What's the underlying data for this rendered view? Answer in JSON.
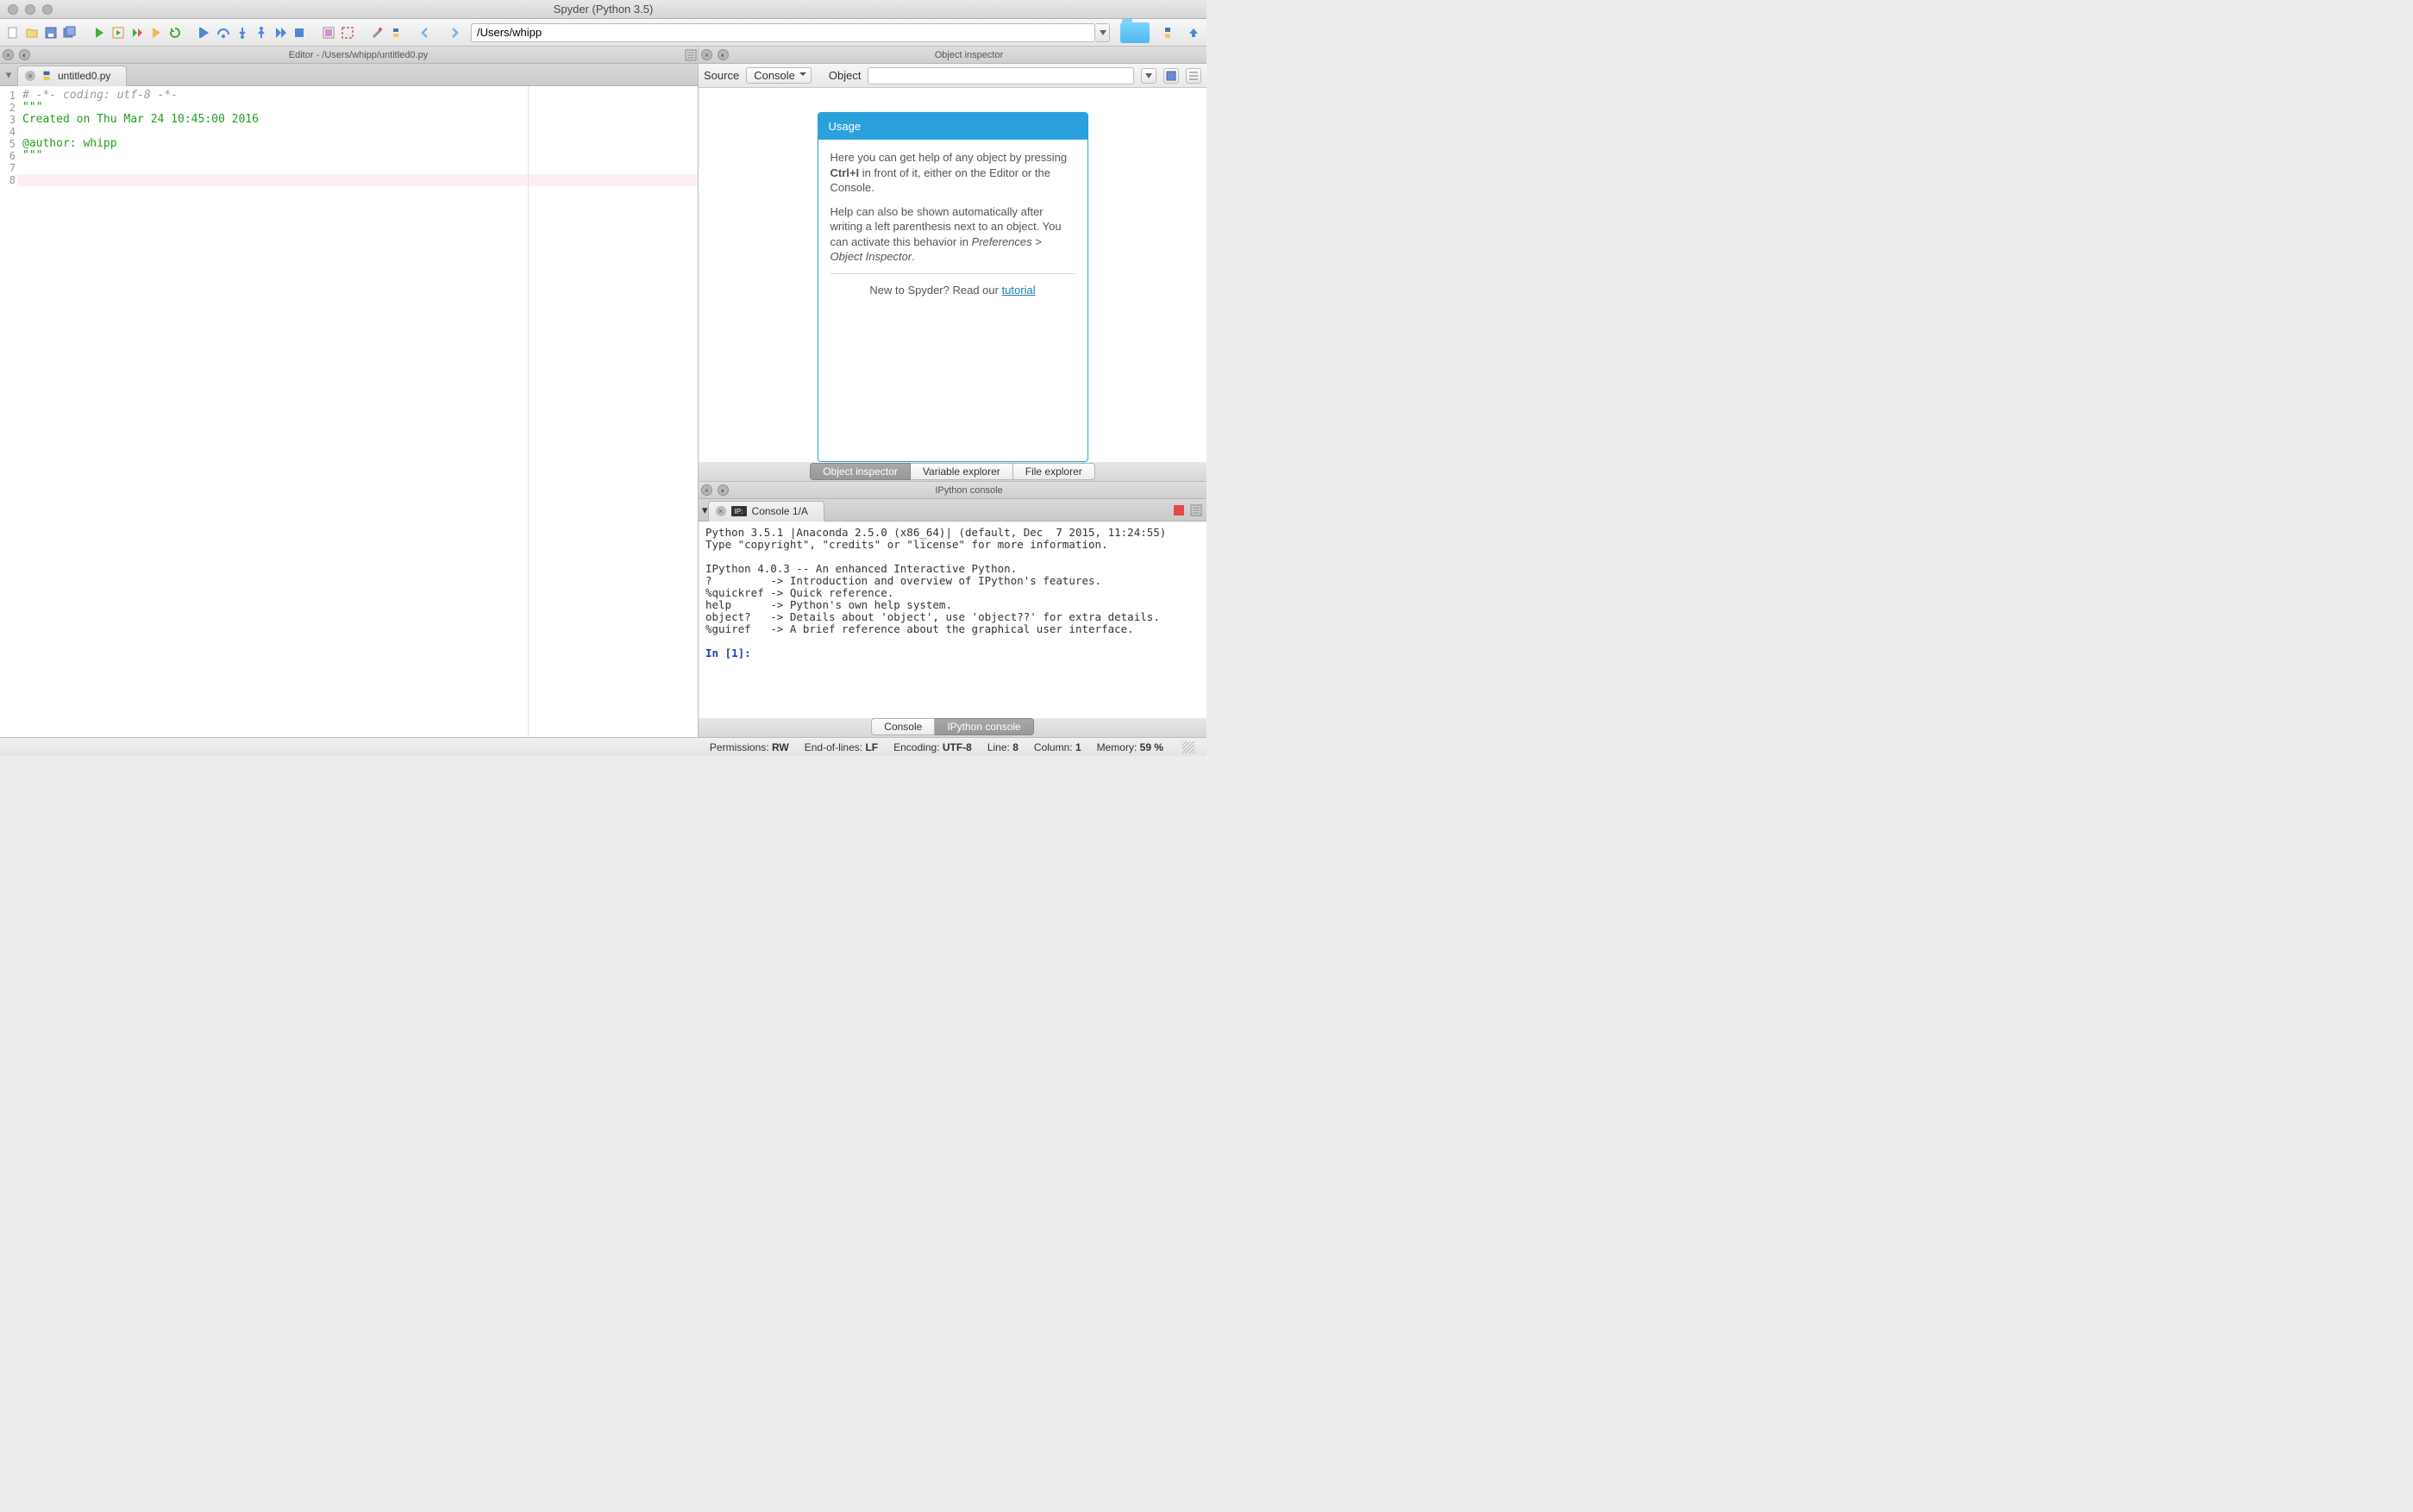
{
  "window": {
    "title": "Spyder (Python 3.5)"
  },
  "toolbar": {
    "working_dir": "/Users/whipp"
  },
  "editor": {
    "pane_title": "Editor - /Users/whipp/untitled0.py",
    "tab_name": "untitled0.py",
    "gutter": "1\n2\n3\n4\n5\n6\n7\n8",
    "line1": "# -*- coding: utf-8 -*-",
    "line2": "\"\"\"",
    "line3": "Created on Thu Mar 24 10:45:00 2016",
    "line4": "",
    "line5": "@author: whipp",
    "line6": "\"\"\"",
    "line7": "",
    "line8": ""
  },
  "inspector": {
    "pane_title": "Object inspector",
    "source_label": "Source",
    "source_value": "Console",
    "object_label": "Object",
    "usage_title": "Usage",
    "usage_p1a": "Here you can get help of any object by pressing ",
    "usage_key": "Ctrl+I",
    "usage_p1b": " in front of it, either on the Editor or the Console.",
    "usage_p2a": "Help can also be shown automatically after writing a left parenthesis next to an object. You can activate this behavior in ",
    "usage_pref": "Preferences > Object Inspector",
    "usage_p2b": ".",
    "usage_foot": "New to Spyder? Read our ",
    "usage_link": "tutorial",
    "tabs": {
      "obj": "Object inspector",
      "var": "Variable explorer",
      "file": "File explorer"
    }
  },
  "console": {
    "pane_title": "IPython console",
    "tab_name": "Console 1/A",
    "l1": "Python 3.5.1 |Anaconda 2.5.0 (x86_64)| (default, Dec  7 2015, 11:24:55) ",
    "l2": "Type \"copyright\", \"credits\" or \"license\" for more information.",
    "l3": "",
    "l4": "IPython 4.0.3 -- An enhanced Interactive Python.",
    "l5": "?         -> Introduction and overview of IPython's features.",
    "l6": "%quickref -> Quick reference.",
    "l7": "help      -> Python's own help system.",
    "l8": "object?   -> Details about 'object', use 'object??' for extra details.",
    "l9": "%guiref   -> A brief reference about the graphical user interface.",
    "prompt": "In [1]: ",
    "tabs": {
      "std": "Console",
      "ipy": "IPython console"
    }
  },
  "status": {
    "perm_l": "Permissions:",
    "perm_v": "RW",
    "eol_l": "End-of-lines:",
    "eol_v": "LF",
    "enc_l": "Encoding:",
    "enc_v": "UTF-8",
    "line_l": "Line:",
    "line_v": "8",
    "col_l": "Column:",
    "col_v": "1",
    "mem_l": "Memory:",
    "mem_v": "59 %"
  }
}
